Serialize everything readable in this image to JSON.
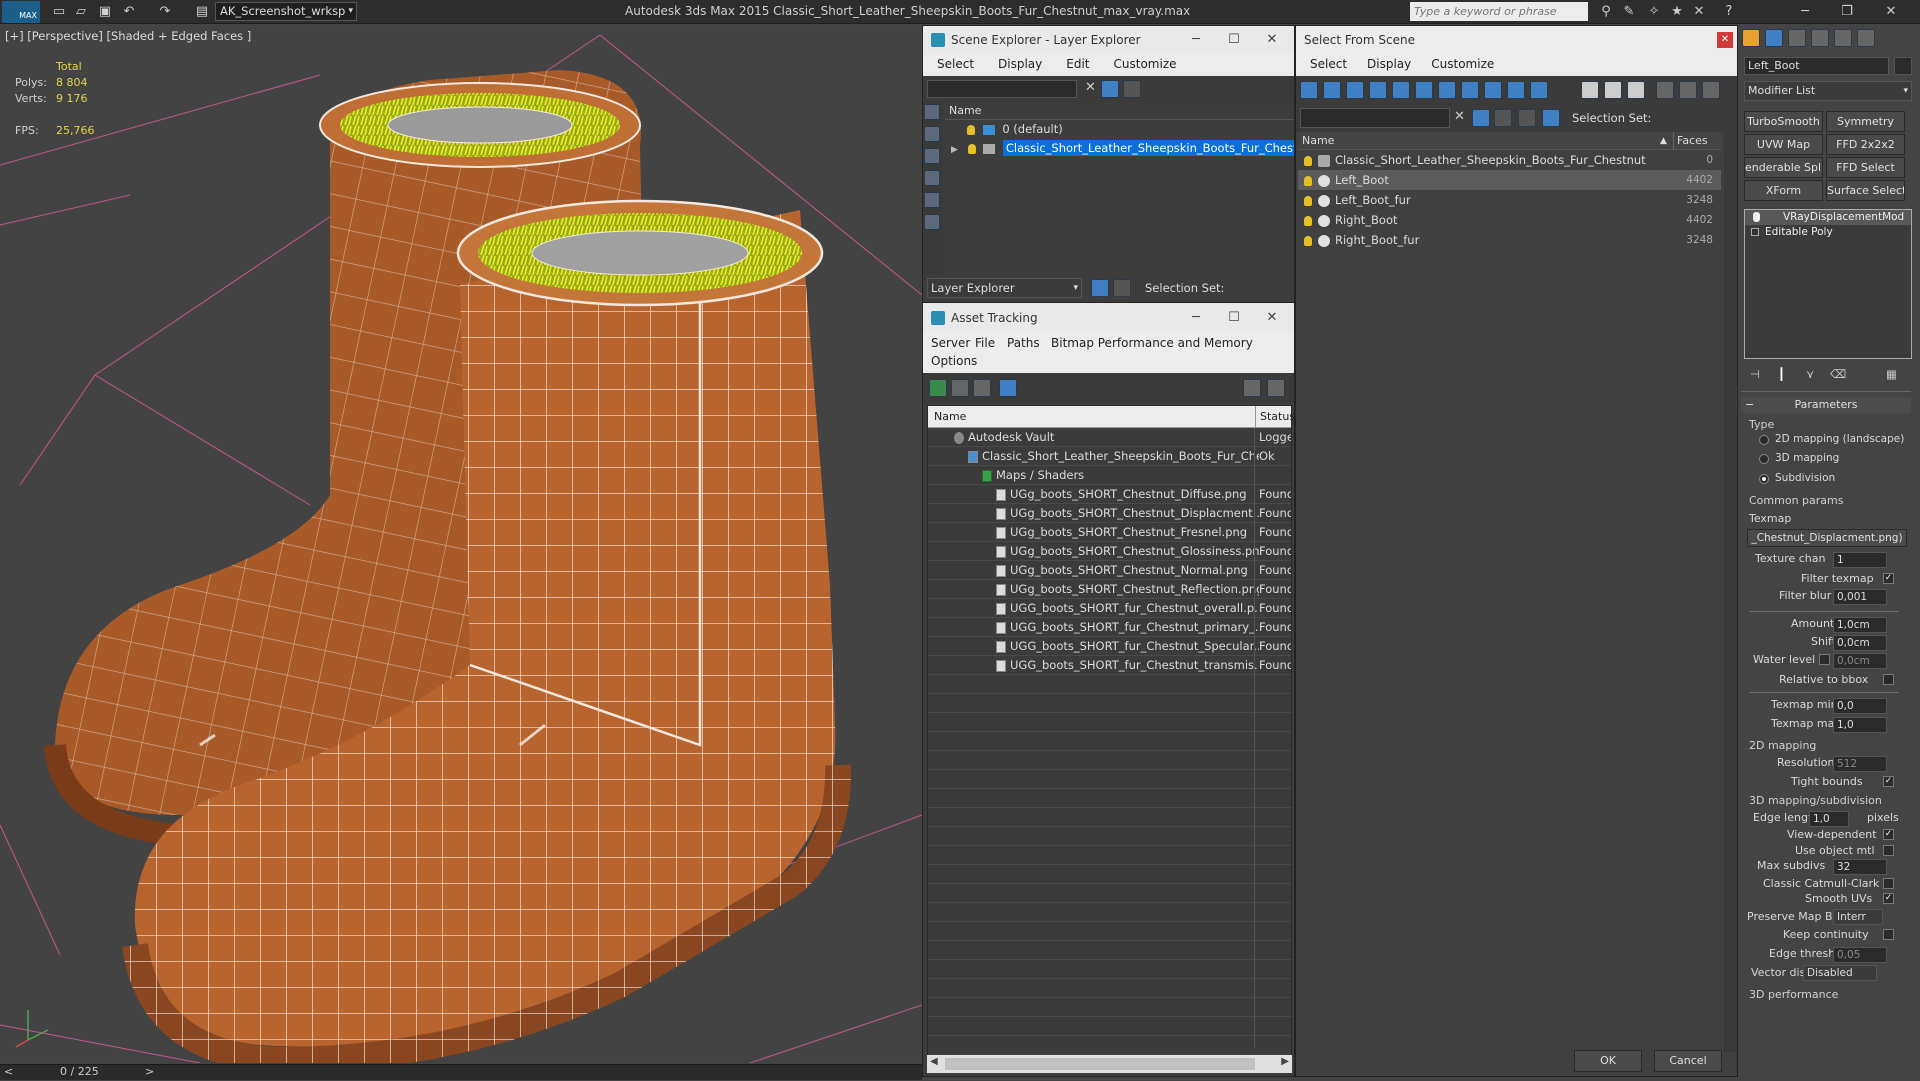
{
  "titlebar": {
    "logo": "MAX",
    "workspace": "AK_Screenshot_wrksp",
    "app_title": "Autodesk 3ds Max  2015    Classic_Short_Leather_Sheepskin_Boots_Fur_Chestnut_max_vray.max",
    "search_placeholder": "Type a keyword or phrase"
  },
  "viewport": {
    "label": "[+] [Perspective] [Shaded + Edged Faces ]",
    "stats": {
      "total_label": "Total",
      "polys_label": "Polys:",
      "polys_value": "8 804",
      "verts_label": "Verts:",
      "verts_value": "9 176",
      "fps_label": "FPS:",
      "fps_value": "25,766"
    },
    "colors": {
      "leather": "#b8642e",
      "wire": "#f2e6dc",
      "fur": "#d6e81a",
      "background": "#434343",
      "grid": "#e25aa0"
    }
  },
  "timeline": {
    "counter": "0 / 225",
    "prev": "<",
    "next": ">"
  },
  "scene_explorer": {
    "title": "Scene Explorer - Layer Explorer",
    "menu": [
      "Select",
      "Display",
      "Edit",
      "Customize"
    ],
    "column": "Name",
    "layers": [
      {
        "name": "0 (default)",
        "selected": false
      },
      {
        "name": "Classic_Short_Leather_Sheepskin_Boots_Fur_Chestnut",
        "selected": true
      }
    ],
    "footer_dropdown": "Layer Explorer",
    "selection_set_label": "Selection Set:"
  },
  "asset_tracking": {
    "title": "Asset Tracking",
    "menu": [
      "Server",
      "File",
      "Paths",
      "Bitmap Performance and Memory"
    ],
    "menu2": "Options",
    "columns": [
      "Name",
      "Status"
    ],
    "rows": [
      {
        "name": "Autodesk Vault",
        "status": "Logge",
        "indent": 1
      },
      {
        "name": "Classic_Short_Leather_Sheepskin_Boots_Fur_Che...",
        "status": "Ok",
        "indent": 2
      },
      {
        "name": "Maps / Shaders",
        "status": "",
        "indent": 3
      },
      {
        "name": "UGg_boots_SHORT_Chestnut_Diffuse.png",
        "status": "Found",
        "indent": 4
      },
      {
        "name": "UGg_boots_SHORT_Chestnut_Displacment....",
        "status": "Found",
        "indent": 4
      },
      {
        "name": "UGg_boots_SHORT_Chestnut_Fresnel.png",
        "status": "Found",
        "indent": 4
      },
      {
        "name": "UGg_boots_SHORT_Chestnut_Glossiness.png",
        "status": "Found",
        "indent": 4
      },
      {
        "name": "UGg_boots_SHORT_Chestnut_Normal.png",
        "status": "Found",
        "indent": 4
      },
      {
        "name": "UGg_boots_SHORT_Chestnut_Reflection.png",
        "status": "Found",
        "indent": 4
      },
      {
        "name": "UGG_boots_SHORT_fur_Chestnut_overall.p...",
        "status": "Found",
        "indent": 4
      },
      {
        "name": "UGG_boots_SHORT_fur_Chestnut_primary_...",
        "status": "Found",
        "indent": 4
      },
      {
        "name": "UGG_boots_SHORT_fur_Chestnut_Specular....",
        "status": "Found",
        "indent": 4
      },
      {
        "name": "UGG_boots_SHORT_fur_Chestnut_transmis...",
        "status": "Found",
        "indent": 4
      }
    ]
  },
  "select_from_scene": {
    "title": "Select From Scene",
    "menu": [
      "Select",
      "Display",
      "Customize"
    ],
    "selection_set_label": "Selection Set:",
    "columns": [
      "Name",
      "Faces"
    ],
    "rows": [
      {
        "name": "Classic_Short_Leather_Sheepskin_Boots_Fur_Chestnut",
        "faces": "0",
        "kind": "layer",
        "selected": false
      },
      {
        "name": "Left_Boot",
        "faces": "4402",
        "kind": "object",
        "selected": true
      },
      {
        "name": "Left_Boot_fur",
        "faces": "3248",
        "kind": "object",
        "selected": false
      },
      {
        "name": "Right_Boot",
        "faces": "4402",
        "kind": "object",
        "selected": false
      },
      {
        "name": "Right_Boot_fur",
        "faces": "3248",
        "kind": "object",
        "selected": false
      }
    ],
    "ok": "OK",
    "cancel": "Cancel"
  },
  "command_panel": {
    "object_name": "Left_Boot",
    "modifier_list": "Modifier List",
    "mod_buttons": [
      "TurboSmooth",
      "Symmetry",
      "UVW Map",
      "FFD 2x2x2",
      "enderable Splin",
      "FFD Select",
      "XForm",
      "Surface Select"
    ],
    "stack": [
      "VRayDisplacementMod",
      "Editable Poly"
    ],
    "params_title": "Parameters",
    "type_label": "Type",
    "type_options": [
      "2D mapping (landscape)",
      "3D mapping",
      "Subdivision"
    ],
    "type_selected": 2,
    "common_params": "Common params",
    "texmap_label": "Texmap",
    "texmap_value": "_Chestnut_Displacment.png)",
    "texture_chan_label": "Texture chan",
    "texture_chan": "1",
    "filter_texmap_label": "Filter texmap",
    "filter_blur_label": "Filter blur",
    "filter_blur": "0,001",
    "amount_label": "Amount",
    "amount": "1,0cm",
    "shift_label": "Shift",
    "shift": "0,0cm",
    "water_level_label": "Water level",
    "water_level": "0,0cm",
    "relative_bbox_label": "Relative to bbox",
    "texmap_min_label": "Texmap min",
    "texmap_min": "0,0",
    "texmap_max_label": "Texmap max",
    "texmap_max": "1,0",
    "mapping2d_label": "2D mapping",
    "resolution_label": "Resolution",
    "resolution": "512",
    "tight_bounds_label": "Tight bounds",
    "mapping3d_label": "3D mapping/subdivision",
    "edge_length_label": "Edge length",
    "edge_length": "1,0",
    "pixels_label": "pixels",
    "view_dependent_label": "View-dependent",
    "use_object_mtl_label": "Use object mtl",
    "max_subdivs_label": "Max subdivs",
    "max_subdivs": "32",
    "catmull_label": "Classic Catmull-Clark",
    "smooth_uvs_label": "Smooth UVs",
    "preserve_map_label": "Preserve Map Bnd",
    "preserve_map": "Interr",
    "keep_continuity_label": "Keep continuity",
    "edge_thresh_label": "Edge thresh",
    "edge_thresh": "0,05",
    "vector_displ_label": "Vector displ",
    "vector_displ": "Disabled",
    "perf_label": "3D performance"
  }
}
